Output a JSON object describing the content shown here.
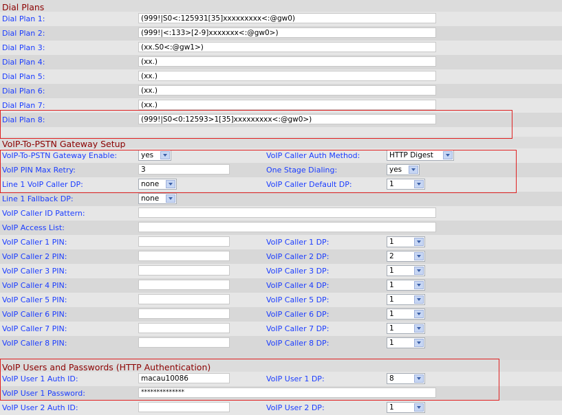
{
  "dial_plans": {
    "title": "Dial Plans",
    "items": [
      {
        "label": "Dial Plan 1:",
        "value": "(999!|S0<:125931[35]xxxxxxxxx<:@gw0)"
      },
      {
        "label": "Dial Plan 2:",
        "value": "(999!|<:133>[2-9]xxxxxxx<:@gw0>)"
      },
      {
        "label": "Dial Plan 3:",
        "value": "(xx.S0<:@gw1>)"
      },
      {
        "label": "Dial Plan 4:",
        "value": "(xx.)"
      },
      {
        "label": "Dial Plan 5:",
        "value": "(xx.)"
      },
      {
        "label": "Dial Plan 6:",
        "value": "(xx.)"
      },
      {
        "label": "Dial Plan 7:",
        "value": "(xx.)"
      },
      {
        "label": "Dial Plan 8:",
        "value": "(999!|S0<0:12593>1[35]xxxxxxxxx<:@gw0>)"
      }
    ]
  },
  "gateway": {
    "title": "VoIP-To-PSTN Gateway Setup",
    "enable_label": "VoIP-To-PSTN Gateway Enable:",
    "enable_value": "yes",
    "auth_method_label": "VoIP Caller Auth Method:",
    "auth_method_value": "HTTP Digest",
    "pin_retry_label": "VoIP PIN Max Retry:",
    "pin_retry_value": "3",
    "one_stage_label": "One Stage Dialing:",
    "one_stage_value": "yes",
    "line1_dp_label": "Line 1 VoIP Caller DP:",
    "line1_dp_value": "none",
    "default_dp_label": "VoIP Caller Default DP:",
    "default_dp_value": "1",
    "fallback_label": "Line 1 Fallback DP:",
    "fallback_value": "none",
    "id_pattern_label": "VoIP Caller ID Pattern:",
    "id_pattern_value": "",
    "access_list_label": "VoIP Access List:",
    "access_list_value": "",
    "callers": [
      {
        "pin_label": "VoIP Caller 1 PIN:",
        "pin_value": "",
        "dp_label": "VoIP Caller 1 DP:",
        "dp_value": "1"
      },
      {
        "pin_label": "VoIP Caller 2 PIN:",
        "pin_value": "",
        "dp_label": "VoIP Caller 2 DP:",
        "dp_value": "2"
      },
      {
        "pin_label": "VoIP Caller 3 PIN:",
        "pin_value": "",
        "dp_label": "VoIP Caller 3 DP:",
        "dp_value": "1"
      },
      {
        "pin_label": "VoIP Caller 4 PIN:",
        "pin_value": "",
        "dp_label": "VoIP Caller 4 DP:",
        "dp_value": "1"
      },
      {
        "pin_label": "VoIP Caller 5 PIN:",
        "pin_value": "",
        "dp_label": "VoIP Caller 5 DP:",
        "dp_value": "1"
      },
      {
        "pin_label": "VoIP Caller 6 PIN:",
        "pin_value": "",
        "dp_label": "VoIP Caller 6 DP:",
        "dp_value": "1"
      },
      {
        "pin_label": "VoIP Caller 7 PIN:",
        "pin_value": "",
        "dp_label": "VoIP Caller 7 DP:",
        "dp_value": "1"
      },
      {
        "pin_label": "VoIP Caller 8 PIN:",
        "pin_value": "",
        "dp_label": "VoIP Caller 8 DP:",
        "dp_value": "1"
      }
    ]
  },
  "users": {
    "title": "VoIP Users and Passwords (HTTP Authentication)",
    "user1_id_label": "VoIP User 1 Auth ID:",
    "user1_id_value": "macau10086",
    "user1_dp_label": "VoIP User 1 DP:",
    "user1_dp_value": "8",
    "user1_pw_label": "VoIP User 1 Password:",
    "user1_pw_value": "**************",
    "user2_id_label": "VoIP User 2 Auth ID:",
    "user2_id_value": "",
    "user2_dp_label": "VoIP User 2 DP:",
    "user2_dp_value": "1"
  },
  "colors": {
    "label": "#1a3cff",
    "section_title": "#8b0000",
    "highlight": "#e02020"
  }
}
